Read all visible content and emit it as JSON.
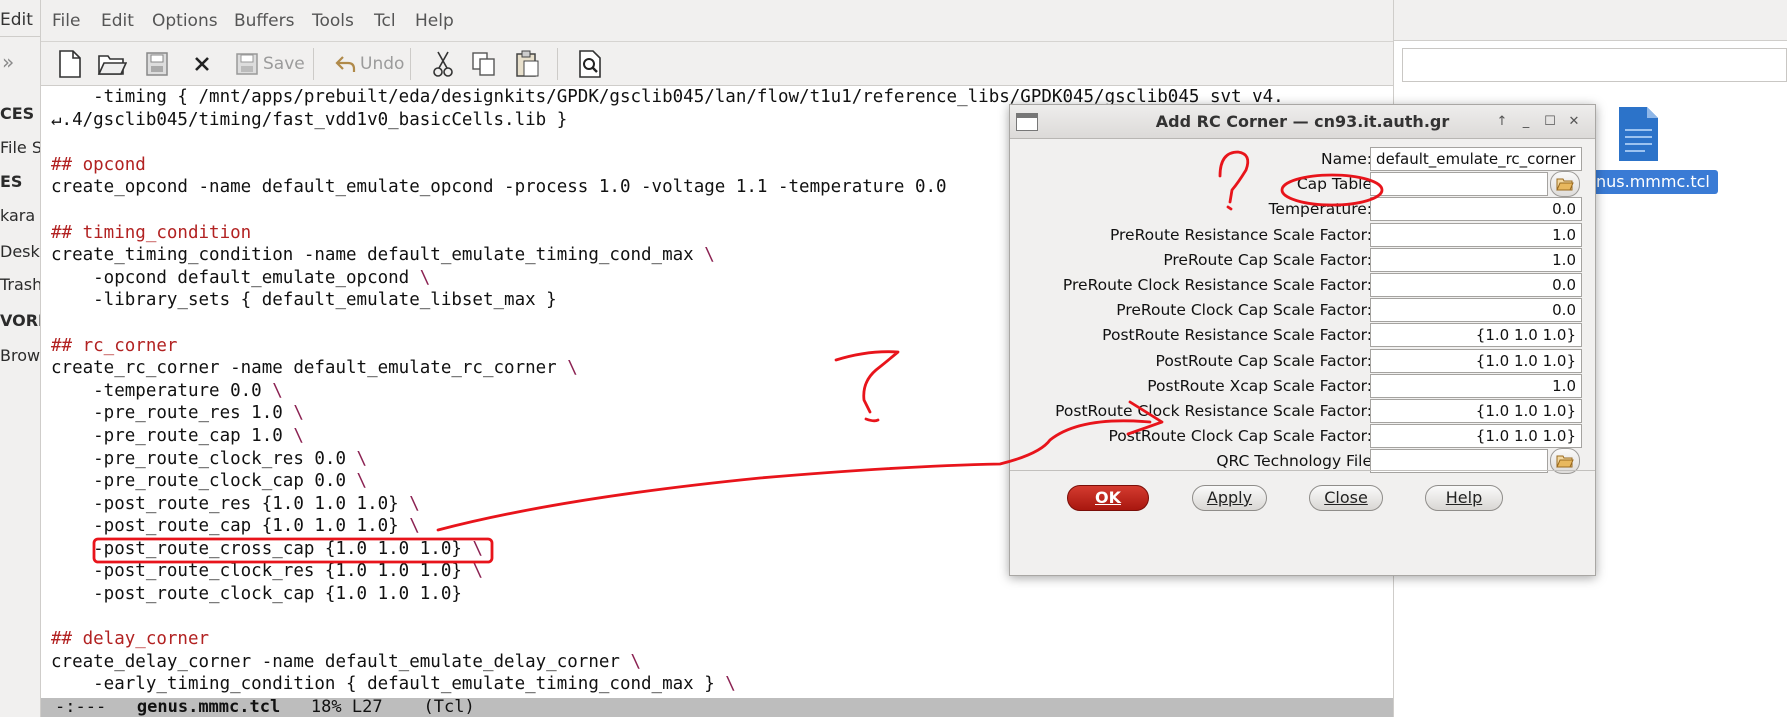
{
  "file_manager": {
    "edit_menu": "Edit",
    "sidebar_items": [
      "CES",
      "File S",
      "ES",
      "kara",
      "Desk",
      "Trash",
      "VORK",
      "Brow"
    ],
    "file_name": "nus.mmmc.tcl"
  },
  "emacs": {
    "menu": [
      "File",
      "Edit",
      "Options",
      "Buffers",
      "Tools",
      "Tcl",
      "Help"
    ],
    "toolbar": {
      "save_label": "Save",
      "undo_label": "Undo"
    },
    "modeline": {
      "status": "-:---",
      "buffer": "genus.mmmc.tcl",
      "position": "18% L27",
      "mode": "(Tcl)"
    }
  },
  "code_lines": [
    [
      {
        "t": "    -timing { /mnt/apps/prebuilt/eda/designkits/GPDK/gsclib045/lan/flow/t1u1/reference_libs/GPDK045/gsclib045_svt_v4.",
        "c": ""
      }
    ],
    [
      {
        "t": "↵.4/gsclib045/timing/fast_vdd1v0_basicCells.lib }",
        "c": ""
      }
    ],
    [
      {
        "t": "",
        "c": ""
      }
    ],
    [
      {
        "t": "## opcond",
        "c": "cm"
      }
    ],
    [
      {
        "t": "create_opcond -name default_emulate_opcond -process 1.0 -voltage 1.1 -temperature 0.0",
        "c": ""
      }
    ],
    [
      {
        "t": "",
        "c": ""
      }
    ],
    [
      {
        "t": "## timing_condition",
        "c": "cm"
      }
    ],
    [
      {
        "t": "create_timing_condition -name default_emulate_timing_cond_max ",
        "c": ""
      },
      {
        "t": "\\",
        "c": "bs"
      }
    ],
    [
      {
        "t": "    -opcond default_emulate_opcond ",
        "c": ""
      },
      {
        "t": "\\",
        "c": "bs"
      }
    ],
    [
      {
        "t": "    -library_sets { default_emulate_libset_max }",
        "c": ""
      }
    ],
    [
      {
        "t": "",
        "c": ""
      }
    ],
    [
      {
        "t": "## rc_corner",
        "c": "cm"
      }
    ],
    [
      {
        "t": "create_rc_corner -name default_emulate_rc_corner ",
        "c": ""
      },
      {
        "t": "\\",
        "c": "bs"
      }
    ],
    [
      {
        "t": "    -temperature 0.0 ",
        "c": ""
      },
      {
        "t": "\\",
        "c": "bs"
      }
    ],
    [
      {
        "t": "    -pre_route_res 1.0 ",
        "c": ""
      },
      {
        "t": "\\",
        "c": "bs"
      }
    ],
    [
      {
        "t": "    -pre_route_cap 1.0 ",
        "c": ""
      },
      {
        "t": "\\",
        "c": "bs"
      }
    ],
    [
      {
        "t": "    -pre_route_clock_res 0.0 ",
        "c": ""
      },
      {
        "t": "\\",
        "c": "bs"
      }
    ],
    [
      {
        "t": "    -pre_route_clock_cap 0.0 ",
        "c": ""
      },
      {
        "t": "\\",
        "c": "bs"
      }
    ],
    [
      {
        "t": "    -post_route_res {1.0 1.0 1.0} ",
        "c": ""
      },
      {
        "t": "\\",
        "c": "bs"
      }
    ],
    [
      {
        "t": "    -post_route_cap {1.0 1.0 1.0} ",
        "c": ""
      },
      {
        "t": "\\",
        "c": "bs"
      }
    ],
    [
      {
        "t": "    -post_route_cross_cap {1.0 1.0 1.0} ",
        "c": ""
      },
      {
        "t": "\\",
        "c": "bs"
      }
    ],
    [
      {
        "t": "    -post_route_clock_res {1.0 1.0 1.0} ",
        "c": ""
      },
      {
        "t": "\\",
        "c": "bs"
      }
    ],
    [
      {
        "t": "    -post_route_clock_cap {1.0 1.0 1.0}",
        "c": ""
      }
    ],
    [
      {
        "t": "",
        "c": ""
      }
    ],
    [
      {
        "t": "## delay_corner",
        "c": "cm"
      }
    ],
    [
      {
        "t": "create_delay_corner -name default_emulate_delay_corner ",
        "c": ""
      },
      {
        "t": "\\",
        "c": "bs"
      }
    ],
    [
      {
        "t": "    -early_timing_condition { default_emulate_timing_cond_max } ",
        "c": ""
      },
      {
        "t": "\\",
        "c": "bs"
      }
    ]
  ],
  "dialog": {
    "title": "Add RC Corner — cn93.it.auth.gr",
    "fields": [
      {
        "label": "Name:",
        "value": "default_emulate_rc_corner",
        "align": "left",
        "browse": false
      },
      {
        "label": "Cap Table",
        "value": "",
        "align": "left",
        "browse": true
      },
      {
        "label": "Temperature:",
        "value": "0.0",
        "align": "right",
        "browse": false
      },
      {
        "label": "PreRoute Resistance Scale Factor:",
        "value": "1.0",
        "align": "right",
        "browse": false
      },
      {
        "label": "PreRoute Cap Scale Factor:",
        "value": "1.0",
        "align": "right",
        "browse": false
      },
      {
        "label": "PreRoute Clock Resistance Scale Factor:",
        "value": "0.0",
        "align": "right",
        "browse": false
      },
      {
        "label": "PreRoute Clock Cap Scale Factor:",
        "value": "0.0",
        "align": "right",
        "browse": false
      },
      {
        "label": "PostRoute Resistance Scale Factor:",
        "value": "{1.0 1.0 1.0}",
        "align": "right",
        "browse": false
      },
      {
        "label": "PostRoute Cap Scale Factor:",
        "value": "{1.0 1.0 1.0}",
        "align": "right",
        "browse": false
      },
      {
        "label": "PostRoute Xcap Scale Factor:",
        "value": "1.0",
        "align": "right",
        "browse": false
      },
      {
        "label": "PostRoute Clock Resistance Scale Factor:",
        "value": "{1.0 1.0 1.0}",
        "align": "right",
        "browse": false
      },
      {
        "label": "PostRoute Clock Cap Scale Factor:",
        "value": "{1.0 1.0 1.0}",
        "align": "right",
        "browse": false
      },
      {
        "label": "QRC Technology File",
        "value": "",
        "align": "left",
        "browse": true
      }
    ],
    "buttons": {
      "ok": "OK",
      "apply": "Apply",
      "close": "Close",
      "help": "Help"
    }
  },
  "annotation_color": "#e8141b"
}
